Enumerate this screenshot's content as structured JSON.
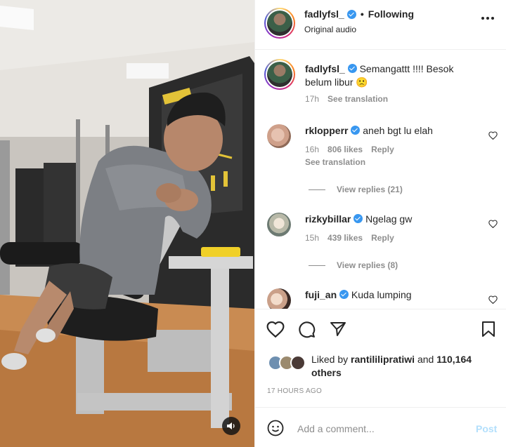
{
  "header": {
    "username": "fadlyfsl_",
    "separator": "•",
    "follow_status": "Following",
    "audio": "Original audio"
  },
  "caption": {
    "username": "fadlyfsl_",
    "text": "Semangattt !!!! Besok belum libur",
    "emoji": "🙁",
    "time": "17h",
    "see_translation": "See translation"
  },
  "comments": [
    {
      "username": "rklopperr",
      "verified": true,
      "text": "aneh bgt lu elah",
      "time": "16h",
      "likes": "806 likes",
      "reply": "Reply",
      "see_translation": "See translation",
      "view_replies": "View replies (21)"
    },
    {
      "username": "rizkybillar",
      "verified": true,
      "text": "Ngelag gw",
      "time": "15h",
      "likes": "439 likes",
      "reply": "Reply",
      "view_replies": "View replies (8)"
    },
    {
      "username": "fuji_an",
      "verified": true,
      "text": "Kuda lumping"
    }
  ],
  "likes": {
    "prefix": "Liked by",
    "user": "rantililipratiwi",
    "and": "and",
    "others": "110,164 others"
  },
  "time_ago": "17 HOURS AGO",
  "add_comment": {
    "placeholder": "Add a comment...",
    "post_label": "Post"
  },
  "icons": {
    "more": "more-icon",
    "heart": "heart-icon",
    "comment": "comment-icon",
    "share": "share-icon",
    "save": "bookmark-icon",
    "emoji": "emoji-icon",
    "mute": "speaker-icon"
  },
  "colors": {
    "verified": "#3897f0",
    "muted_text": "#8e8e8e",
    "post_disabled": "#b2dffc"
  }
}
